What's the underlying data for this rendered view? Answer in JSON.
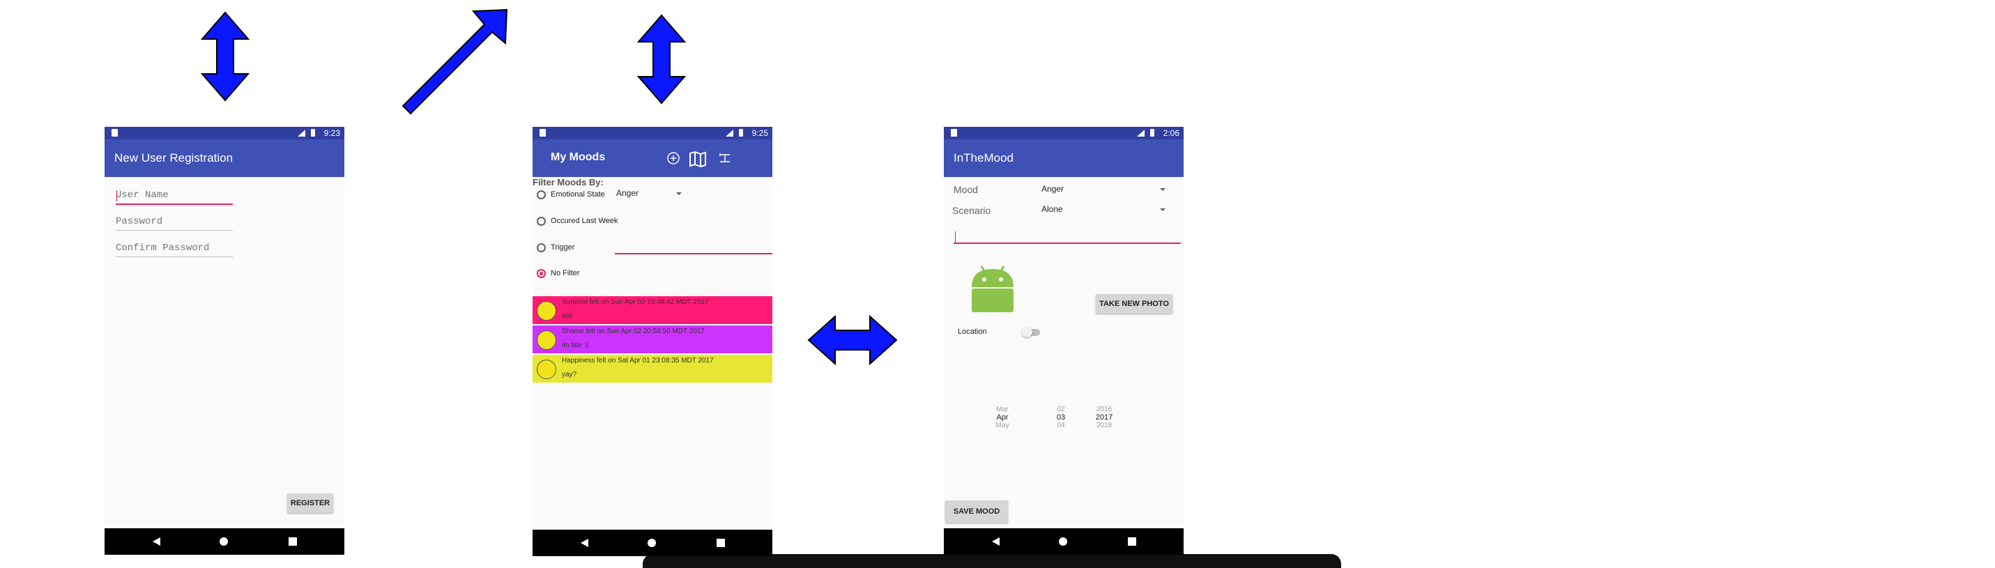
{
  "screen1": {
    "time": "9:23",
    "title": "New User Registration",
    "username_placeholder": "User Name",
    "password_placeholder": "Password",
    "confirm_placeholder": "Confirm Password",
    "register_label": "REGISTER"
  },
  "screen2": {
    "time": "9:25",
    "title": "My Moods",
    "filter_heading": "Filter Moods By:",
    "options": [
      "Emotional State",
      "Occured Last Week",
      "Trigger",
      "No Filter"
    ],
    "selected_option": "No Filter",
    "emotion_value": "Anger",
    "moods": [
      {
        "line1": "Surprise felt on Sun Apr 02 15:48:42 MDT 2017",
        "line2": "wat",
        "color": "#ff1a75"
      },
      {
        "line1": "Shame felt on Sun Apr 02 20:58:50 MDT 2017",
        "line2": "im late :(",
        "color": "#cc33ff"
      },
      {
        "line1": "Happiness felt on Sat Apr 01 23:08:35 MDT 2017",
        "line2": "yay?",
        "color": "#e6e633"
      }
    ]
  },
  "screen3": {
    "time": "2:06",
    "title": "InTheMood",
    "mood_label": "Mood",
    "mood_value": "Anger",
    "scenario_label": "Scenario",
    "scenario_value": "Alone",
    "take_photo_label": "TAKE NEW PHOTO",
    "location_label": "Location",
    "date_picker": {
      "months": [
        "Mar",
        "Apr",
        "May"
      ],
      "days": [
        "02",
        "03",
        "04"
      ],
      "years": [
        "2016",
        "2017",
        "2018"
      ]
    },
    "save_label": "SAVE MOOD"
  },
  "colors": {
    "status_bar": "#303f9f",
    "app_bar": "#3f51b5",
    "accent": "#e91e63",
    "arrow": "#0a17ff"
  },
  "icons": [
    "up-down-arrow-icon",
    "diagonal-arrow-icon",
    "left-right-arrow-icon",
    "android-robot-icon",
    "add-icon",
    "map-icon",
    "filter-icon"
  ]
}
